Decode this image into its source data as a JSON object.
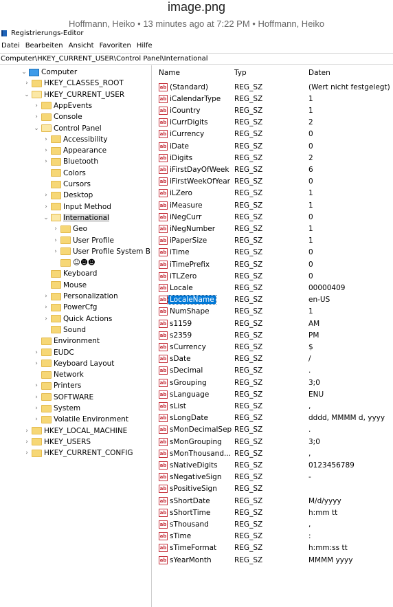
{
  "header": {
    "title": "image.png",
    "meta": "Hoffmann, Heiko • 13 minutes ago at 7:22 PM • Hoffmann, Heiko"
  },
  "window": {
    "title": "Registrierungs-Editor"
  },
  "menu": [
    "Datei",
    "Bearbeiten",
    "Ansicht",
    "Favoriten",
    "Hilfe"
  ],
  "address": "Computer\\HKEY_CURRENT_USER\\Control Panel\\International",
  "tree": [
    {
      "label": "Computer",
      "depth": 0,
      "expander": "open",
      "icon": "computer-icon"
    },
    {
      "label": "HKEY_CLASSES_ROOT",
      "depth": 1,
      "expander": "closed"
    },
    {
      "label": "HKEY_CURRENT_USER",
      "depth": 1,
      "expander": "open"
    },
    {
      "label": "AppEvents",
      "depth": 2,
      "expander": "closed"
    },
    {
      "label": "Console",
      "depth": 2,
      "expander": "closed"
    },
    {
      "label": "Control Panel",
      "depth": 2,
      "expander": "open"
    },
    {
      "label": "Accessibility",
      "depth": 3,
      "expander": "closed"
    },
    {
      "label": "Appearance",
      "depth": 3,
      "expander": "closed"
    },
    {
      "label": "Bluetooth",
      "depth": 3,
      "expander": "closed"
    },
    {
      "label": "Colors",
      "depth": 3,
      "expander": "none"
    },
    {
      "label": "Cursors",
      "depth": 3,
      "expander": "none"
    },
    {
      "label": "Desktop",
      "depth": 3,
      "expander": "closed"
    },
    {
      "label": "Input Method",
      "depth": 3,
      "expander": "closed"
    },
    {
      "label": "International",
      "depth": 3,
      "expander": "open",
      "selected": true
    },
    {
      "label": "Geo",
      "depth": 4,
      "expander": "closed"
    },
    {
      "label": "User Profile",
      "depth": 4,
      "expander": "closed"
    },
    {
      "label": "User Profile System B",
      "depth": 4,
      "expander": "closed"
    },
    {
      "label": "☺☻☻",
      "depth": 4,
      "expander": "none"
    },
    {
      "label": "Keyboard",
      "depth": 3,
      "expander": "none"
    },
    {
      "label": "Mouse",
      "depth": 3,
      "expander": "none"
    },
    {
      "label": "Personalization",
      "depth": 3,
      "expander": "closed"
    },
    {
      "label": "PowerCfg",
      "depth": 3,
      "expander": "closed"
    },
    {
      "label": "Quick Actions",
      "depth": 3,
      "expander": "closed"
    },
    {
      "label": "Sound",
      "depth": 3,
      "expander": "none"
    },
    {
      "label": "Environment",
      "depth": 2,
      "expander": "none"
    },
    {
      "label": "EUDC",
      "depth": 2,
      "expander": "closed"
    },
    {
      "label": "Keyboard Layout",
      "depth": 2,
      "expander": "closed"
    },
    {
      "label": "Network",
      "depth": 2,
      "expander": "none"
    },
    {
      "label": "Printers",
      "depth": 2,
      "expander": "closed"
    },
    {
      "label": "SOFTWARE",
      "depth": 2,
      "expander": "closed"
    },
    {
      "label": "System",
      "depth": 2,
      "expander": "closed"
    },
    {
      "label": "Volatile Environment",
      "depth": 2,
      "expander": "closed"
    },
    {
      "label": "HKEY_LOCAL_MACHINE",
      "depth": 1,
      "expander": "closed"
    },
    {
      "label": "HKEY_USERS",
      "depth": 1,
      "expander": "closed"
    },
    {
      "label": "HKEY_CURRENT_CONFIG",
      "depth": 1,
      "expander": "closed"
    }
  ],
  "columns": {
    "name": "Name",
    "type": "Typ",
    "data": "Daten"
  },
  "values": [
    {
      "name": "(Standard)",
      "type": "REG_SZ",
      "data": "(Wert nicht festgelegt)"
    },
    {
      "name": "iCalendarType",
      "type": "REG_SZ",
      "data": "1"
    },
    {
      "name": "iCountry",
      "type": "REG_SZ",
      "data": "1"
    },
    {
      "name": "iCurrDigits",
      "type": "REG_SZ",
      "data": "2"
    },
    {
      "name": "iCurrency",
      "type": "REG_SZ",
      "data": "0"
    },
    {
      "name": "iDate",
      "type": "REG_SZ",
      "data": "0"
    },
    {
      "name": "iDigits",
      "type": "REG_SZ",
      "data": "2"
    },
    {
      "name": "iFirstDayOfWeek",
      "type": "REG_SZ",
      "data": "6"
    },
    {
      "name": "iFirstWeekOfYear",
      "type": "REG_SZ",
      "data": "0"
    },
    {
      "name": "iLZero",
      "type": "REG_SZ",
      "data": "1"
    },
    {
      "name": "iMeasure",
      "type": "REG_SZ",
      "data": "1"
    },
    {
      "name": "iNegCurr",
      "type": "REG_SZ",
      "data": "0"
    },
    {
      "name": "iNegNumber",
      "type": "REG_SZ",
      "data": "1"
    },
    {
      "name": "iPaperSize",
      "type": "REG_SZ",
      "data": "1"
    },
    {
      "name": "iTime",
      "type": "REG_SZ",
      "data": "0"
    },
    {
      "name": "iTimePrefix",
      "type": "REG_SZ",
      "data": "0"
    },
    {
      "name": "iTLZero",
      "type": "REG_SZ",
      "data": "0"
    },
    {
      "name": "Locale",
      "type": "REG_SZ",
      "data": "00000409"
    },
    {
      "name": "LocaleName",
      "type": "REG_SZ",
      "data": "en-US",
      "selected": true
    },
    {
      "name": "NumShape",
      "type": "REG_SZ",
      "data": "1"
    },
    {
      "name": "s1159",
      "type": "REG_SZ",
      "data": "AM"
    },
    {
      "name": "s2359",
      "type": "REG_SZ",
      "data": "PM"
    },
    {
      "name": "sCurrency",
      "type": "REG_SZ",
      "data": "$"
    },
    {
      "name": "sDate",
      "type": "REG_SZ",
      "data": "/"
    },
    {
      "name": "sDecimal",
      "type": "REG_SZ",
      "data": "."
    },
    {
      "name": "sGrouping",
      "type": "REG_SZ",
      "data": "3;0"
    },
    {
      "name": "sLanguage",
      "type": "REG_SZ",
      "data": "ENU"
    },
    {
      "name": "sList",
      "type": "REG_SZ",
      "data": ","
    },
    {
      "name": "sLongDate",
      "type": "REG_SZ",
      "data": "dddd, MMMM d, yyyy"
    },
    {
      "name": "sMonDecimalSep",
      "type": "REG_SZ",
      "data": "."
    },
    {
      "name": "sMonGrouping",
      "type": "REG_SZ",
      "data": "3;0"
    },
    {
      "name": "sMonThousand...",
      "type": "REG_SZ",
      "data": ","
    },
    {
      "name": "sNativeDigits",
      "type": "REG_SZ",
      "data": "0123456789"
    },
    {
      "name": "sNegativeSign",
      "type": "REG_SZ",
      "data": "-"
    },
    {
      "name": "sPositiveSign",
      "type": "REG_SZ",
      "data": ""
    },
    {
      "name": "sShortDate",
      "type": "REG_SZ",
      "data": "M/d/yyyy"
    },
    {
      "name": "sShortTime",
      "type": "REG_SZ",
      "data": "h:mm tt"
    },
    {
      "name": "sThousand",
      "type": "REG_SZ",
      "data": ","
    },
    {
      "name": "sTime",
      "type": "REG_SZ",
      "data": ":"
    },
    {
      "name": "sTimeFormat",
      "type": "REG_SZ",
      "data": "h:mm:ss tt"
    },
    {
      "name": "sYearMonth",
      "type": "REG_SZ",
      "data": "MMMM yyyy"
    }
  ],
  "icons": {
    "value_type_glyph": "ab",
    "value_type_color": "#c5303b",
    "selection_color": "#0078d7"
  }
}
